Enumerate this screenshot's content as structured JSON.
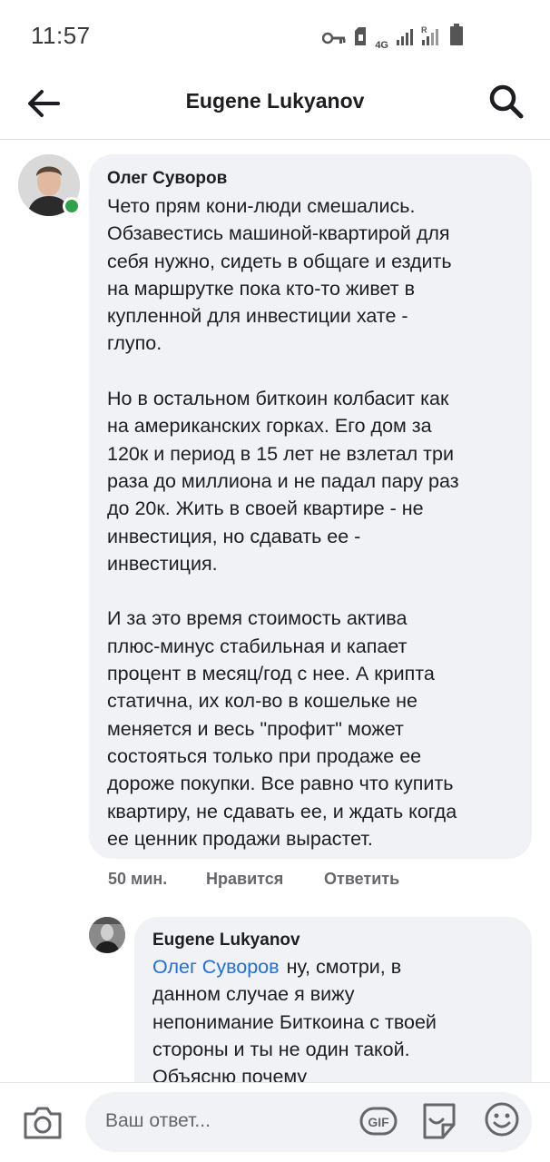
{
  "status_bar": {
    "time": "11:57",
    "network": "4G",
    "roaming": "R"
  },
  "header": {
    "title": "Eugene Lukyanov",
    "back_icon": "arrow-left-icon",
    "search_icon": "search-icon"
  },
  "comment": {
    "author": "Олег Суворов",
    "online": true,
    "paragraphs": [
      [
        "Чето прям кони-люди смешались.",
        "Обзавестись машиной-квартирой для",
        "себя нужно, сидеть в общаге и ездить",
        "на маршрутке пока кто-то живет в",
        "купленной для инвестиции хате -",
        "глупо."
      ],
      [
        "Но в остальном биткоин колбасит как",
        "на американских горках. Его дом за",
        "120к и период в 15 лет не взлетал три",
        "раза до миллиона и не падал пару раз",
        "до 20к. Жить в своей квартире - не",
        "инвестиция, но сдавать ее -",
        "инвестиция."
      ],
      [
        "И за это время стоимость актива",
        "плюс-минус стабильная и капает",
        "процент в месяц/год с нее. А крипта",
        "статична, их кол-во в кошельке не",
        "меняется и весь \"профит\" может",
        "состояться только при продаже ее",
        "дороже покупки. Все равно что купить",
        "квартиру, не сдавать ее, и ждать когда",
        "ее ценник продажи вырастет."
      ]
    ],
    "timestamp": "50 мин.",
    "like_label": "Нравится",
    "reply_label": "Ответить"
  },
  "reply": {
    "author": "Eugene Lukyanov",
    "mention": "Олег Суворов",
    "first_line": "ну, смотри, в",
    "lines": [
      "данном случае я вижу",
      "непонимание Биткоина с твоей",
      "стороны и ты не один такой.",
      "Объясню почему"
    ]
  },
  "composer": {
    "placeholder": "Ваш ответ...",
    "camera_icon": "camera-icon",
    "gif_label": "GIF",
    "sticker_icon": "sticker-icon",
    "emoji_icon": "emoji-icon"
  }
}
